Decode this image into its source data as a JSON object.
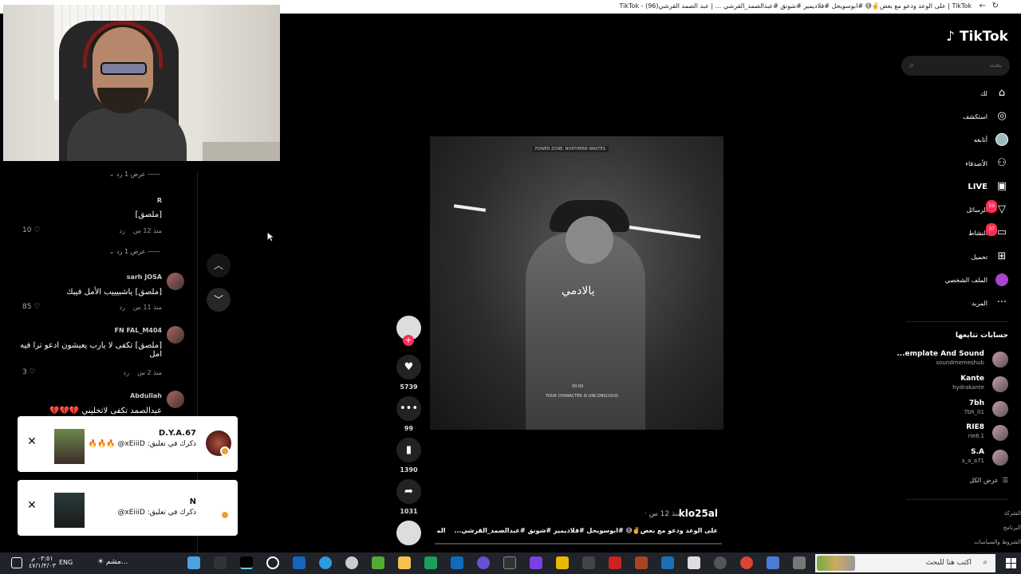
{
  "browser": {
    "tab_title": "TikTok | على الوعد ودعو مع بعض✌️😅 #ابوسويحل #فلاديمير #شونق #عبدالصمد_القرشي ... | عبد الصمد القرشي(96) - TikTok",
    "back": "←",
    "reload": "↻"
  },
  "comments": {
    "view_replies": "عرض 1 رد",
    "items": [
      {
        "name": "R",
        "text": "[ملصق]",
        "time": "منذ 12 س",
        "reply": "رد",
        "likes": "10"
      },
      {
        "name": "sarh JOSA",
        "text": "[ملصق] ياشبيييب الأمل فيبك",
        "time": "منذ 11 س",
        "reply": "رد",
        "likes": "85"
      },
      {
        "name": "FN FAL_M404",
        "text": "[ملصق] تكفى لا يارب يعيشون ادعو ترا فيه امل",
        "time": "منذ 2 س",
        "reply": "رد",
        "likes": "3"
      },
      {
        "name": "Abdullah",
        "text": "عبدالصمد تكفى لاتخليني 💔💔💔"
      }
    ]
  },
  "notifications": [
    {
      "name": "D.Y.A.67",
      "text": "ذكرك في تعليق: xEiiiD@ 🔥🔥🔥",
      "close": "✕"
    },
    {
      "name": "N",
      "text": "ذكرك في تعليق: xEiiiD@",
      "close": "✕"
    }
  ],
  "nav_arrows": {
    "up": "︿",
    "down": "﹀"
  },
  "video": {
    "hud_top": "POWER ZONE: NORTHERN WASTES",
    "subtitle": "يالادمي",
    "hud_timer": "00:00",
    "hud_status": "YOUR CHARACTER IS UNCONSCIOUS"
  },
  "actions": {
    "likes": "5739",
    "comments": "99",
    "saves": "1390",
    "shares": "1031"
  },
  "post": {
    "author": "klo25al",
    "time": "منذ 12 س",
    "caption": "على الوعد ودعو مع بعض✌️😅 #ابوسويحل #فلاديمير #شونق #عبدالصمد_القرشي...",
    "more": "المزيد"
  },
  "sidebar": {
    "logo": "TikTok",
    "search_placeholder": "بحث",
    "nav": [
      {
        "label": "لك",
        "icon": "home-icon"
      },
      {
        "label": "استكشف",
        "icon": "compass-icon"
      },
      {
        "label": "أتابعه",
        "icon": "following-icon"
      },
      {
        "label": "الأصدقاء",
        "icon": "friends-icon"
      },
      {
        "label": "LIVE",
        "icon": "live-icon"
      },
      {
        "label": "الرسائل",
        "icon": "messages-icon",
        "badge": "59"
      },
      {
        "label": "النشاط",
        "icon": "activity-icon",
        "badge": "37"
      },
      {
        "label": "تحميل",
        "icon": "upload-icon"
      },
      {
        "label": "الملف الشخصي",
        "icon": "profile-icon"
      },
      {
        "label": "المزيد",
        "icon": "more-icon"
      }
    ],
    "following_title": "حسابات تتابعها",
    "accounts": [
      {
        "name": "...emplate And Sound",
        "handle": "soundmemeshub"
      },
      {
        "name": "Kante",
        "handle": "hydrakante"
      },
      {
        "name": "7bh",
        "handle": "7bh_01"
      },
      {
        "name": "RIE8",
        "handle": "rie8.1"
      },
      {
        "name": "S.A",
        "handle": "s_a_a71"
      }
    ],
    "see_all": "عرض الكل",
    "footer": [
      "الشركة",
      "البرنامج",
      "الشروط والسياسات"
    ]
  },
  "taskbar": {
    "search_placeholder": "اكتب هنا للبحث",
    "lang": "ENG",
    "time": "٠٣:٥١ م",
    "date": "٤٧/١/٣/٠٣",
    "weather": "مشم..."
  }
}
